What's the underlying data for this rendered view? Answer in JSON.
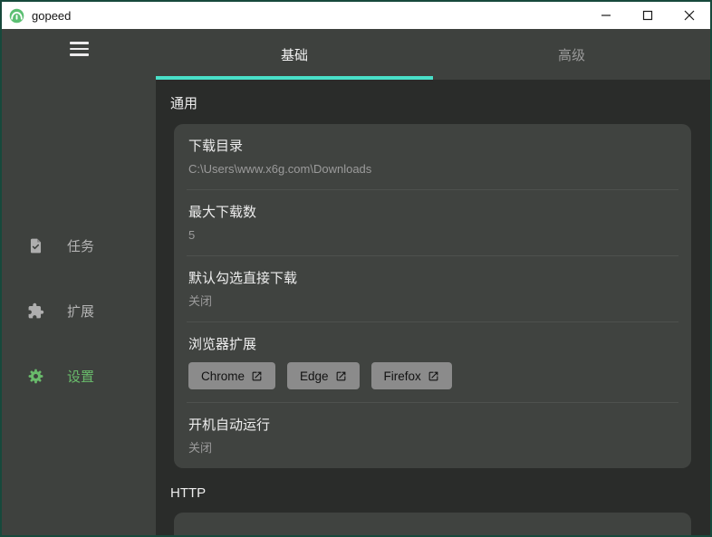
{
  "window": {
    "title": "gopeed",
    "controls": [
      {
        "name": "minimize",
        "icon": "minimize-icon"
      },
      {
        "name": "maximize",
        "icon": "maximize-icon"
      },
      {
        "name": "close",
        "icon": "close-icon"
      }
    ]
  },
  "colors": {
    "accent_teal": "#49dfc8",
    "accent_green": "#69bb6b",
    "window_border": "#17493c",
    "sidebar_bg": "#3e413e",
    "content_bg": "#2a2c2a",
    "card_bg": "#404340",
    "button_bg": "#8b8b8b"
  },
  "sidebar": {
    "menu_icon": "hamburger-icon",
    "items": [
      {
        "label": "任务",
        "icon": "task-icon",
        "active": false
      },
      {
        "label": "扩展",
        "icon": "extension-icon",
        "active": false
      },
      {
        "label": "设置",
        "icon": "gear-icon",
        "active": true
      }
    ]
  },
  "tabs": [
    {
      "label": "基础",
      "active": true
    },
    {
      "label": "高级",
      "active": false
    }
  ],
  "general": {
    "section_title": "通用",
    "items": [
      {
        "title": "下载目录",
        "value": "C:\\Users\\www.x6g.com\\Downloads"
      },
      {
        "title": "最大下载数",
        "value": "5"
      },
      {
        "title": "默认勾选直接下载",
        "value": "关闭"
      },
      {
        "title": "浏览器扩展",
        "buttons": [
          {
            "label": "Chrome",
            "icon": "open-in-new-icon"
          },
          {
            "label": "Edge",
            "icon": "open-in-new-icon"
          },
          {
            "label": "Firefox",
            "icon": "open-in-new-icon"
          }
        ]
      },
      {
        "title": "开机自动运行",
        "value": "关闭"
      }
    ]
  },
  "http": {
    "section_title": "HTTP"
  }
}
